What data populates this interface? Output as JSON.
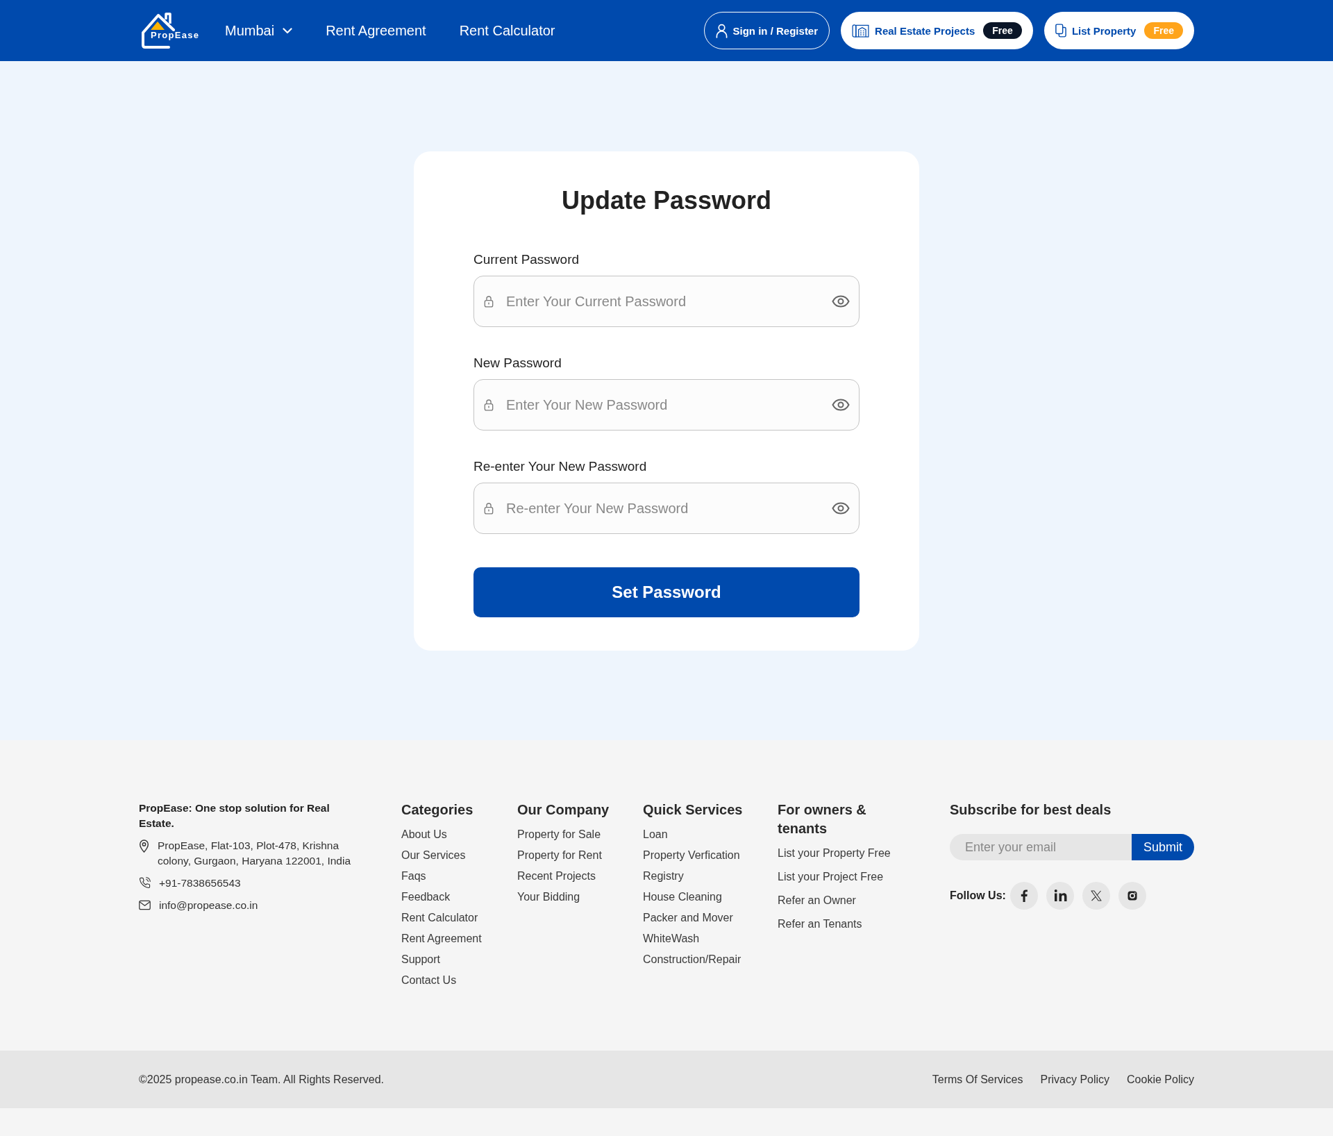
{
  "header": {
    "logo": "PropEase",
    "city": "Mumbai",
    "nav": [
      "Rent Agreement",
      "Rent Calculator"
    ],
    "actions": [
      {
        "kind": "outline",
        "label": "Sign in / Register"
      },
      {
        "kind": "pill",
        "label": "Real Estate Projects",
        "badge": {
          "text": "Free",
          "color": "#0b1628"
        }
      },
      {
        "kind": "pill",
        "label": "List Property",
        "badge": {
          "text": "Free",
          "color": "#ffa41b"
        }
      }
    ]
  },
  "form": {
    "title": "Update Password",
    "fields": [
      {
        "label": "Current Password",
        "placeholder": "Enter Your Current Password"
      },
      {
        "label": "New Password",
        "placeholder": "Enter Your New Password"
      },
      {
        "label": "Re-enter Your New Password",
        "placeholder": "Re-enter Your New Password"
      }
    ],
    "submit": "Set Password"
  },
  "footer": {
    "about": {
      "headline": "PropEase: One stop solution for Real Estate.",
      "address": "PropEase, Flat-103, Plot-478, Krishna colony, Gurgaon, Haryana 122001, India",
      "phone": "+91-7838656543",
      "email": "info@propease.co.in"
    },
    "columns": [
      {
        "title": "Categories",
        "links": [
          "About Us",
          "Our Services",
          "Faqs",
          "Feedback",
          "Rent Calculator",
          "Rent Agreement",
          "Support",
          "Contact Us"
        ]
      },
      {
        "title": "Our Company",
        "links": [
          "Property for Sale",
          "Property for Rent",
          "Recent Projects",
          "Your Bidding"
        ]
      },
      {
        "title": "Quick Services",
        "links": [
          "Loan",
          "Property Verfication",
          "Registry",
          "House Cleaning",
          "Packer and Mover",
          "WhiteWash",
          "Construction/Repair"
        ]
      },
      {
        "title": "For owners & tenants",
        "links": [
          "List your Property Free",
          "List your Project Free",
          "Refer an Owner",
          "Refer an Tenants"
        ]
      }
    ],
    "subscribe": {
      "title": "Subscribe for best deals",
      "placeholder": "Enter your email",
      "button": "Submit",
      "follow_label": "Follow Us:"
    }
  },
  "bottom_bar": {
    "copyright": "©2025 propease.co.in Team. All Rights Reserved.",
    "links": [
      "Terms Of Services",
      "Privacy Policy",
      "Cookie Policy"
    ]
  }
}
